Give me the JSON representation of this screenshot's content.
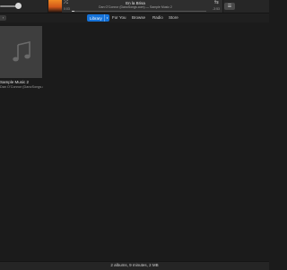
{
  "player": {
    "song_title": "En la Brisa",
    "song_subtitle": "Dan O'Connor (DanoSongs.com) — Sample Music 2",
    "elapsed": "0:03",
    "remaining": "-3:53",
    "progress": 0.02,
    "shuffle_icon": "shuffle-icon",
    "repeat_icon": "repeat-icon",
    "list_icon": "list-icon"
  },
  "nav": {
    "back_glyph": "‹",
    "library_label": "Library",
    "tabs": [
      {
        "label": "For You"
      },
      {
        "label": "Browse"
      },
      {
        "label": "Radio"
      },
      {
        "label": "Store"
      }
    ]
  },
  "albums": [
    {
      "title": "Sample Music 2",
      "artist": "Dan O'Connor (DanoSongs.c..."
    }
  ],
  "status": {
    "summary": "2 albums, 9 minutes, 2 MB"
  },
  "colors": {
    "accent": "#1572d8",
    "background": "#1b1b1b"
  }
}
